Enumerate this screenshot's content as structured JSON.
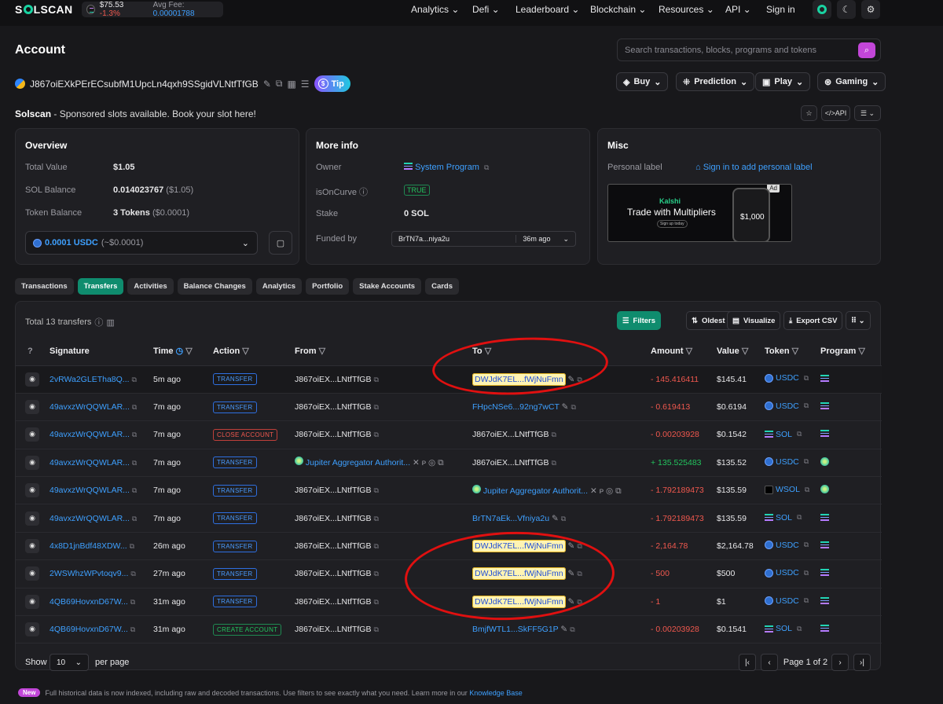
{
  "brand": {
    "logo": "SOLSCAN",
    "sol_price": "$75.53",
    "sol_change": "-1.3%",
    "avg_fee_label": "Avg Fee:",
    "avg_fee": "0.00001788"
  },
  "nav": [
    "Analytics",
    "Defi",
    "Leaderboard",
    "Blockchain",
    "Resources",
    "API",
    "Sign in"
  ],
  "page_title": "Account",
  "search_placeholder": "Search transactions, blocks, programs and tokens",
  "address": "J867oiEXkPErECsubfM1UpcLn4qxh9SSgidVLNtfTfGB",
  "tip": "Tip",
  "top_buttons": [
    "Buy",
    "Prediction",
    "Play",
    "Gaming"
  ],
  "sponsor": {
    "name": "Solscan",
    "text": " - Sponsored slots available. Book your slot here!"
  },
  "api_label": "API",
  "overview": {
    "title": "Overview",
    "rows": [
      {
        "label": "Total Value",
        "value": "$1.05",
        "sub": ""
      },
      {
        "label": "SOL Balance",
        "value": "0.014023767",
        "sub": "($1.05)"
      },
      {
        "label": "Token Balance",
        "value": "3 Tokens",
        "sub": "($0.0001)"
      }
    ],
    "select_amount": "0.0001 USDC",
    "select_sub": "(~$0.0001)"
  },
  "moreinfo": {
    "title": "More info",
    "owner_label": "Owner",
    "owner": "System Program",
    "curve_label": "isOnCurve",
    "curve": "TRUE",
    "stake_label": "Stake",
    "stake": "0 SOL",
    "funded_label": "Funded by",
    "funded": "BrTN7a...niya2u",
    "funded_time": "36m ago"
  },
  "misc": {
    "title": "Misc",
    "label": "Personal label",
    "link": "Sign in to add personal label",
    "ad_badge": "Ad",
    "ad_brand": "Kalshi",
    "ad_headline": "Trade with Multipliers",
    "ad_cta": "Sign up today",
    "ad_price": "$1,000"
  },
  "tabs": [
    "Transactions",
    "Transfers",
    "Activities",
    "Balance Changes",
    "Analytics",
    "Portfolio",
    "Stake Accounts",
    "Cards"
  ],
  "transfers": {
    "total": "Total 13 transfers",
    "buttons": [
      "Filters",
      "Oldest First",
      "Visualize",
      "Export CSV"
    ],
    "headers": [
      "Signature",
      "Time",
      "Action",
      "From",
      "To",
      "Amount",
      "Value",
      "Token",
      "Program"
    ],
    "rows": [
      {
        "sig": "2vRWa2GLETha8Q...",
        "time": "5m ago",
        "action": "TRANSFER",
        "from": "J867oiEX...LNtfTfGB",
        "to": "DWJdK7EL...fWjNuFmn",
        "amount": "- 145.416411",
        "value": "$145.41",
        "token": "USDC"
      },
      {
        "sig": "49avxzWrQQWLAR...",
        "time": "7m ago",
        "action": "TRANSFER",
        "from": "J867oiEX...LNtfTfGB",
        "to": "FHpcNSe6...92ng7wCT",
        "amount": "- 0.619413",
        "value": "$0.6194",
        "token": "USDC"
      },
      {
        "sig": "49avxzWrQQWLAR...",
        "time": "7m ago",
        "action": "CLOSE ACCOUNT",
        "from": "J867oiEX...LNtfTfGB",
        "to": "J867oiEX...LNtfTfGB",
        "amount": "- 0.00203928",
        "value": "$0.1542",
        "token": "SOL"
      },
      {
        "sig": "49avxzWrQQWLAR...",
        "time": "7m ago",
        "action": "TRANSFER",
        "from": "Jupiter Aggregator Authorit...",
        "to": "J867oiEX...LNtfTfGB",
        "amount": "+ 135.525483",
        "value": "$135.52",
        "token": "USDC"
      },
      {
        "sig": "49avxzWrQQWLAR...",
        "time": "7m ago",
        "action": "TRANSFER",
        "from": "J867oiEX...LNtfTfGB",
        "to": "Jupiter Aggregator Authorit...",
        "amount": "- 1.792189473",
        "value": "$135.59",
        "token": "WSOL"
      },
      {
        "sig": "49avxzWrQQWLAR...",
        "time": "7m ago",
        "action": "TRANSFER",
        "from": "J867oiEX...LNtfTfGB",
        "to": "BrTN7aEk...Vfniya2u",
        "amount": "- 1.792189473",
        "value": "$135.59",
        "token": "SOL"
      },
      {
        "sig": "4x8D1jnBdf48XDW...",
        "time": "26m ago",
        "action": "TRANSFER",
        "from": "J867oiEX...LNtfTfGB",
        "to": "DWJdK7EL...fWjNuFmn",
        "amount": "- 2,164.78",
        "value": "$2,164.78",
        "token": "USDC"
      },
      {
        "sig": "2WSWhzWPvtoqv9...",
        "time": "27m ago",
        "action": "TRANSFER",
        "from": "J867oiEX...LNtfTfGB",
        "to": "DWJdK7EL...fWjNuFmn",
        "amount": "- 500",
        "value": "$500",
        "token": "USDC"
      },
      {
        "sig": "4QB69HovxnD67W...",
        "time": "31m ago",
        "action": "TRANSFER",
        "from": "J867oiEX...LNtfTfGB",
        "to": "DWJdK7EL...fWjNuFmn",
        "amount": "- 1",
        "value": "$1",
        "token": "USDC"
      },
      {
        "sig": "4QB69HovxnD67W...",
        "time": "31m ago",
        "action": "CREATE ACCOUNT",
        "from": "J867oiEX...LNtfTfGB",
        "to": "BmjfWTL1...SkFF5G1P",
        "amount": "- 0.00203928",
        "value": "$0.1541",
        "token": "SOL"
      }
    ]
  },
  "pagination": {
    "show": "Show",
    "per_page_value": "10",
    "per_page": "per page",
    "page": "Page 1 of 2"
  },
  "footer": {
    "badge": "New",
    "text": "Full historical data is now indexed, including raw and decoded transactions. Use filters to see exactly what you need. Learn more in our ",
    "link": "Knowledge Base"
  }
}
